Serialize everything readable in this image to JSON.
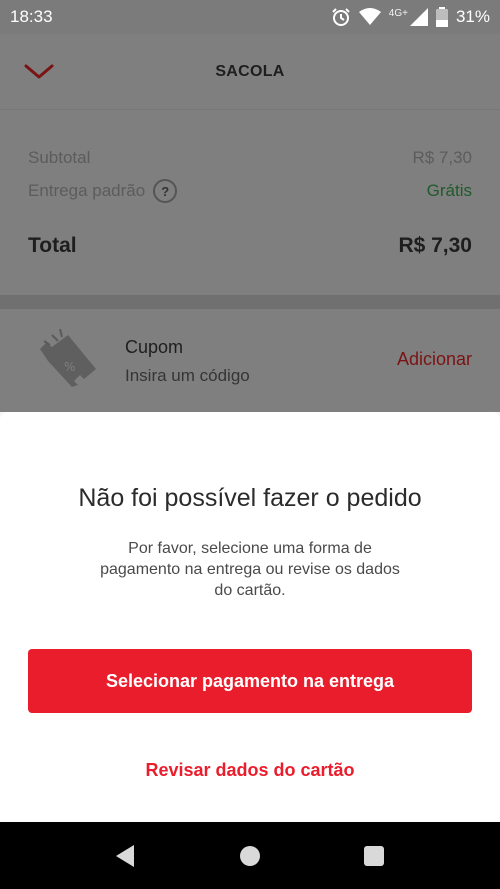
{
  "status_bar": {
    "time": "18:33",
    "network": "4G+",
    "battery": "31%",
    "icons": [
      "alarm-icon",
      "wifi-icon",
      "signal-icon",
      "battery-icon"
    ]
  },
  "header": {
    "title": "SACOLA",
    "back_icon": "chevron-down-icon"
  },
  "summary": {
    "subtotal_label": "Subtotal",
    "subtotal_value": "R$ 7,30",
    "delivery_label": "Entrega padrão",
    "delivery_help": "?",
    "delivery_value": "Grátis",
    "total_label": "Total",
    "total_value": "R$ 7,30"
  },
  "coupon": {
    "icon": "ticket-icon",
    "title": "Cupom",
    "subtitle": "Insira um código",
    "action": "Adicionar"
  },
  "modal": {
    "heading": "Não foi possível fazer o pedido",
    "message": "Por favor, selecione uma forma de pagamento na entrega ou revise os dados do cartão.",
    "primary_button": "Selecionar pagamento na entrega",
    "secondary_button": "Revisar dados do cartão"
  },
  "colors": {
    "accent": "#ea1d2c",
    "free_green": "#1f5b2c",
    "overlay": "#7f7f7f"
  }
}
